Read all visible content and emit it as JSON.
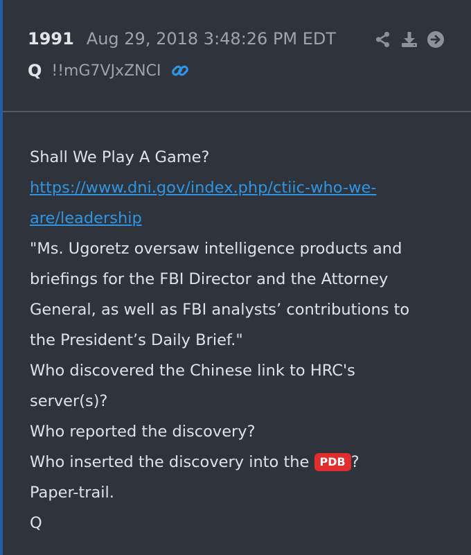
{
  "post": {
    "number": "1991",
    "timestamp": "Aug 29, 2018 3:48:26 PM EDT",
    "author": "Q",
    "tripcode": "!!mG7VJxZNCI",
    "icons": {
      "link": "link-icon",
      "share": "share-icon",
      "download": "download-icon",
      "forward": "forward-arrow-icon"
    },
    "colors": {
      "background": "#2f343c",
      "accent_border": "#1f5fa8",
      "link": "#2f95e3",
      "badge": "#e02d2d"
    }
  },
  "body": {
    "line1": "Shall We Play A Game?",
    "link_line1": "https://www.dni.gov/index.php/ctiic-who-we-",
    "link_line2": "are/leadership",
    "quote_line1": "\"Ms. Ugoretz oversaw intelligence products and",
    "quote_line2": "briefings for the FBI Director and the Attorney",
    "quote_line3": "General, as well as FBI analysts’ contributions to",
    "quote_line4": "the President’s Daily Brief.\"",
    "q1_line1": "Who discovered the Chinese link to HRC's",
    "q1_line2": "server(s)?",
    "q2": "Who reported the discovery?",
    "q3_prefix": "Who inserted the discovery into the ",
    "q3_badge": "PDB",
    "q3_suffix": "?",
    "closing": "Paper-trail.",
    "signature": "Q"
  }
}
